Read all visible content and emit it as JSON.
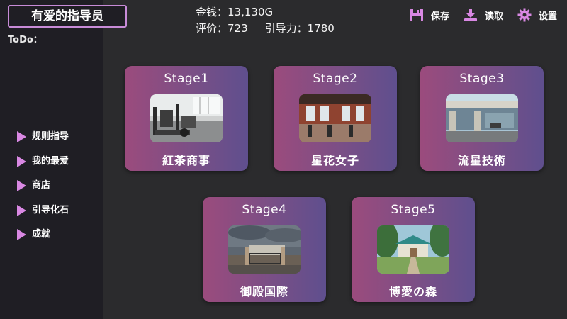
{
  "app": {
    "title": "有爱的指导员",
    "todo_label": "ToDo："
  },
  "stats": {
    "money_label": "金钱：",
    "money_value": "13,130G",
    "rating_label": "评价：",
    "rating_value": "723",
    "guide_label": "引导力：",
    "guide_value": "1780"
  },
  "toolbar": {
    "save_label": "保存",
    "load_label": "读取",
    "settings_label": "设置",
    "save_icon": "floppy-disk-icon",
    "load_icon": "download-icon",
    "settings_icon": "gear-icon"
  },
  "menu": {
    "items": [
      {
        "label": "规则指导"
      },
      {
        "label": "我的最爱"
      },
      {
        "label": "商店"
      },
      {
        "label": "引导化石"
      },
      {
        "label": "成就"
      }
    ]
  },
  "stages": [
    {
      "title": "Stage1",
      "name": "紅茶商事",
      "scene": "gym"
    },
    {
      "title": "Stage2",
      "name": "星花女子",
      "scene": "hall"
    },
    {
      "title": "Stage3",
      "name": "流星技術",
      "scene": "building"
    },
    {
      "title": "Stage4",
      "name": "御殿国際",
      "scene": "gate"
    },
    {
      "title": "Stage5",
      "name": "博愛の森",
      "scene": "forest"
    }
  ],
  "colors": {
    "accent": "#d988e3",
    "card_left": "#9b4b7d",
    "card_right": "#5f4f8e",
    "background": "#2b2b2d",
    "sidebar": "#1f1e24"
  }
}
